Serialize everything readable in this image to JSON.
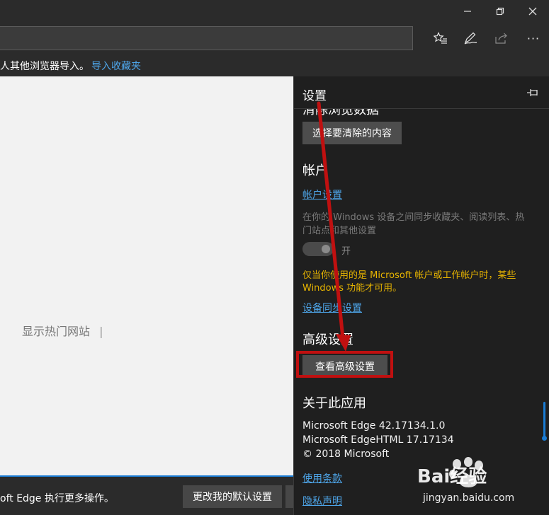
{
  "window": {
    "minimize_label": "—",
    "maximize_label": "❐",
    "close_label": "✕"
  },
  "toolbar": {
    "icons": [
      "favorites-icon",
      "pen-icon",
      "share-icon",
      "more-icon"
    ],
    "more_label": "···"
  },
  "favorites_bar": {
    "hint": "人其他浏览器导入。",
    "import_link": "导入收藏夹"
  },
  "main": {
    "top_sites_label": "显示热门网站",
    "cursor": "|"
  },
  "notification": {
    "message": "oft Edge 执行更多操作。",
    "default_button": "更改我的默认设置"
  },
  "settings": {
    "title": "设置",
    "clear_heading": "清除浏览数据",
    "clear_button": "选择要清除的内容",
    "account_heading": "帐户",
    "account_link": "帐户设置",
    "sync_desc_line1": "在你的 Windows 设备之间同步收藏夹、阅读列表、热",
    "sync_desc_line2": "门站点和其他设置",
    "sync_toggle_label": "开",
    "sync_warn_line1": "仅当你使用的是 Microsoft 帐户或工作帐户时，某些",
    "sync_warn_line2": "Windows 功能才可用。",
    "device_sync_link": "设备同步设置",
    "advanced_heading": "高级设置",
    "advanced_button": "查看高级设置",
    "about_heading": "关于此应用",
    "version_edge": "Microsoft Edge 42.17134.1.0",
    "version_html": "Microsoft EdgeHTML 17.17134",
    "copyright": "© 2018 Microsoft",
    "terms_link": "使用条款",
    "privacy_link": "隐私声明"
  },
  "watermark": {
    "brand": "Bai经验",
    "url": "jingyan.baidu.com"
  },
  "colors": {
    "link": "#4ea6ea",
    "warning": "#e7b400",
    "annotation": "#c01010",
    "accent": "#1a7cd4"
  }
}
